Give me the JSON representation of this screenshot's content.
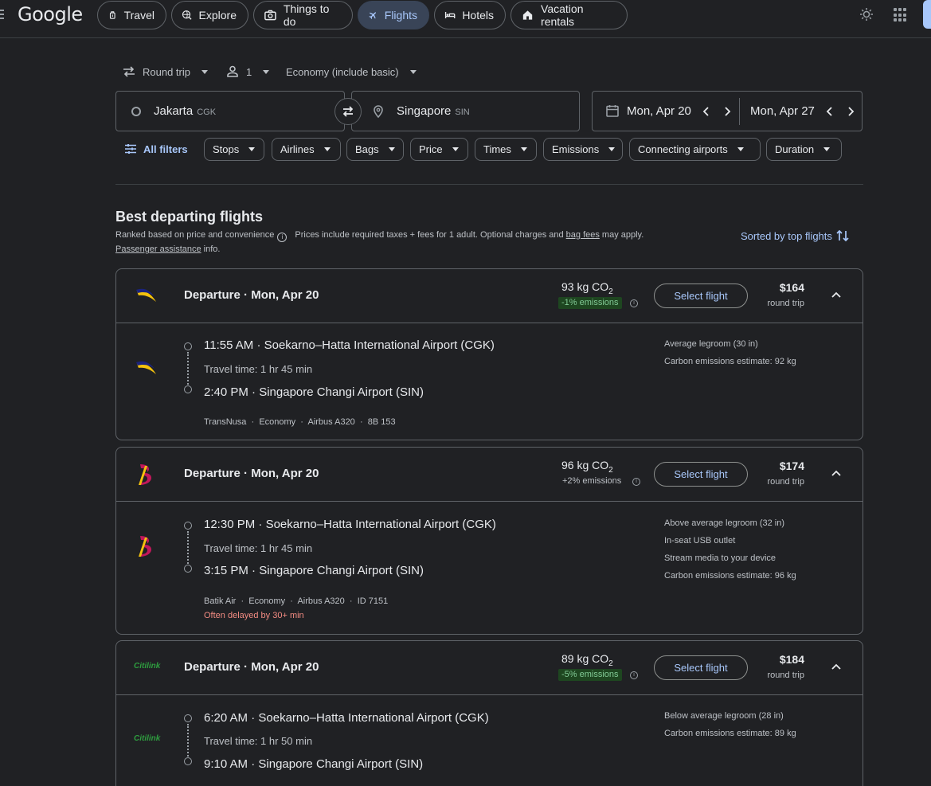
{
  "header": {
    "logo": "Google",
    "nav": [
      {
        "label": "Travel"
      },
      {
        "label": "Explore"
      },
      {
        "label": "Things to do"
      },
      {
        "label": "Flights",
        "active": true
      },
      {
        "label": "Hotels"
      },
      {
        "label": "Vacation rentals"
      }
    ]
  },
  "search": {
    "trip_type": "Round trip",
    "passengers": "1",
    "cabin": "Economy (include basic)",
    "origin_city": "Jakarta",
    "origin_code": "CGK",
    "dest_city": "Singapore",
    "dest_code": "SIN",
    "depart_date": "Mon, Apr 20",
    "return_date": "Mon, Apr 27"
  },
  "filters": {
    "all_label": "All filters",
    "chips": [
      "Stops",
      "Airlines",
      "Bags",
      "Price",
      "Times",
      "Emissions",
      "Connecting airports",
      "Duration"
    ]
  },
  "results": {
    "heading": "Best departing flights",
    "ranked": "Ranked based on price and convenience",
    "prices_pre": "Prices include required taxes + fees for 1 adult. Optional charges and ",
    "bag_fees": "bag fees",
    "prices_post": " may apply.",
    "passenger_assist": "Passenger assistance",
    "info_suffix": " info.",
    "sorted_label": "Sorted by top flights"
  },
  "flights": [
    {
      "departure_label": "Departure",
      "date": "Mon, Apr 20",
      "co2": "93 kg CO",
      "emissions": "-1% emissions",
      "select": "Select flight",
      "price": "$164",
      "price_sub": "round trip",
      "dep_time": "11:55 AM",
      "dep_airport": "Soekarno–Hatta International Airport (CGK)",
      "travel_time": "Travel time: 1 hr 45 min",
      "arr_time": "2:40 PM",
      "arr_airport": "Singapore Changi Airport (SIN)",
      "airline": "TransNusa",
      "cabin": "Economy",
      "aircraft": "Airbus A320",
      "flight_no": "8B 153",
      "amenities": [
        "Average legroom (30 in)",
        "Carbon emissions estimate: 92 kg"
      ],
      "logo": "transnusa-logo",
      "colors": {
        "primary": "#f4c20d",
        "secondary": "#1a237e"
      }
    },
    {
      "departure_label": "Departure",
      "date": "Mon, Apr 20",
      "co2": "96 kg CO",
      "emissions": "+2% emissions",
      "select": "Select flight",
      "price": "$174",
      "price_sub": "round trip",
      "dep_time": "12:30 PM",
      "dep_airport": "Soekarno–Hatta International Airport (CGK)",
      "travel_time": "Travel time: 1 hr 45 min",
      "arr_time": "3:15 PM",
      "arr_airport": "Singapore Changi Airport (SIN)",
      "airline": "Batik Air",
      "cabin": "Economy",
      "aircraft": "Airbus A320",
      "flight_no": "ID 7151",
      "delay": "Often delayed by 30+ min",
      "amenities": [
        "Above average legroom (32 in)",
        "In-seat USB outlet",
        "Stream media to your device",
        "Carbon emissions estimate: 96 kg"
      ],
      "logo": "batik-air-logo",
      "colors": {
        "primary": "#c2185b",
        "secondary": "#f4c20d"
      }
    },
    {
      "departure_label": "Departure",
      "date": "Mon, Apr 20",
      "co2": "89 kg CO",
      "emissions": "-5% emissions",
      "select": "Select flight",
      "price": "$184",
      "price_sub": "round trip",
      "dep_time": "6:20 AM",
      "dep_airport": "Soekarno–Hatta International Airport (CGK)",
      "travel_time": "Travel time: 1 hr 50 min",
      "arr_time": "9:10 AM",
      "arr_airport": "Singapore Changi Airport (SIN)",
      "amenities": [
        "Below average legroom (28 in)",
        "Carbon emissions estimate: 89 kg"
      ],
      "logo": "citilink-logo",
      "logo_text": "Citilink",
      "colors": {
        "primary": "#2e9e3f"
      }
    }
  ],
  "co2_subscript": "2",
  "separator": "·",
  "theme": {
    "bg": "#202124",
    "accent": "#a8c7fa",
    "border": "#5f6368",
    "good": "#81c995",
    "warn": "#f28b82"
  }
}
